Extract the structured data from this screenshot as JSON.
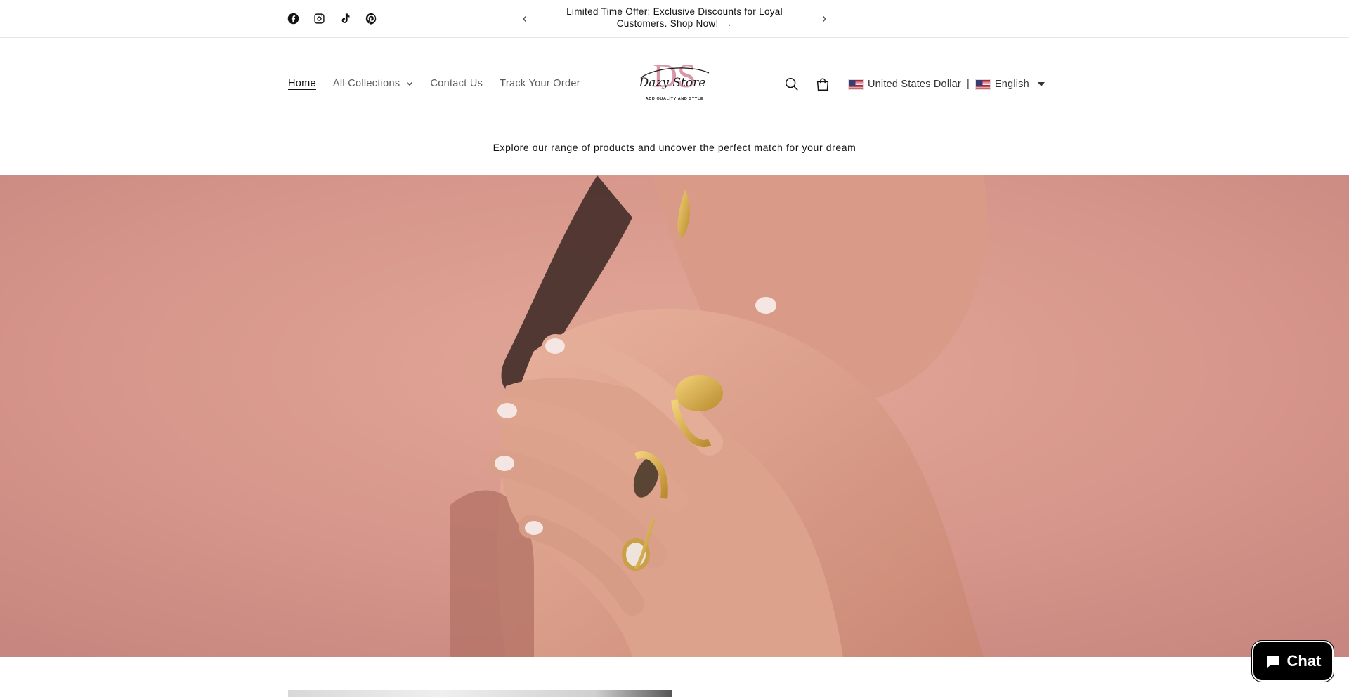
{
  "announcement": {
    "socials": [
      "facebook-icon",
      "instagram-icon",
      "tiktok-icon",
      "pinterest-icon"
    ],
    "text": "Limited Time Offer: Exclusive Discounts for Loyal Customers. Shop Now!",
    "arrow": "→"
  },
  "header": {
    "nav": {
      "home": "Home",
      "collections": "All Collections",
      "contact": "Contact Us",
      "track": "Track Your Order"
    },
    "logo": {
      "monogram": "DS",
      "script": "Dazy Store",
      "tagline": "ADD QUALITY AND STYLE"
    },
    "currency": "United States Dollar",
    "separator": "|",
    "language": "English"
  },
  "tagline": "Explore our range of products and uncover the perfect match for your dream",
  "chat": {
    "label": "Chat"
  },
  "colors": {
    "hero_background": "#d6958a",
    "accent_pink": "#d4869a",
    "text": "#121212"
  }
}
